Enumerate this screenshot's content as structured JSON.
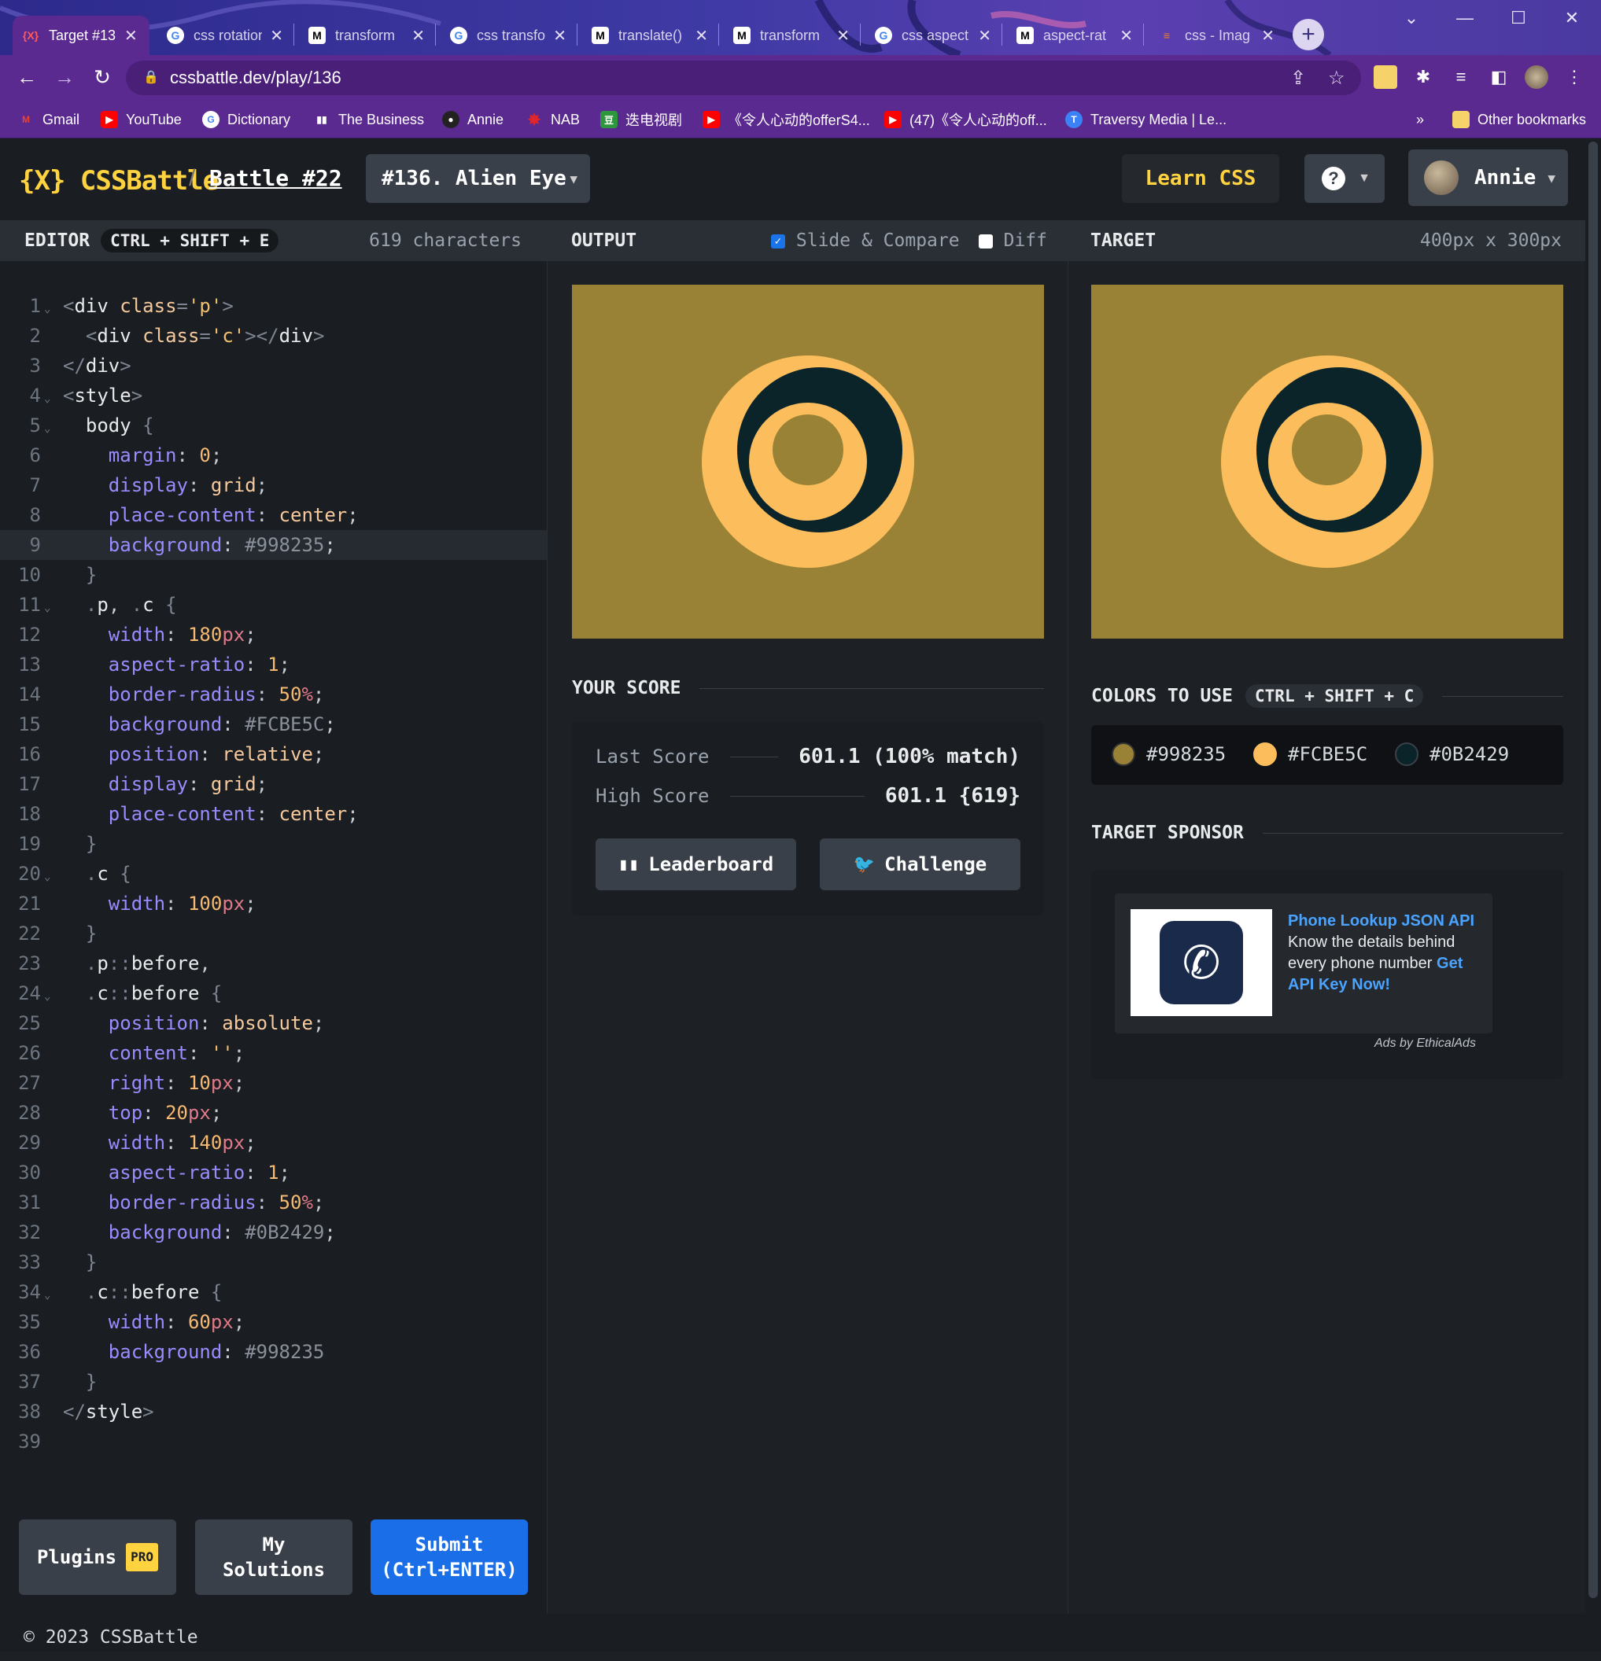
{
  "browser": {
    "tabs": [
      {
        "label": "Target #13",
        "icon": "cssbattle-icon",
        "active": true
      },
      {
        "label": "css rotation",
        "icon": "google-icon"
      },
      {
        "label": "transform",
        "icon": "mdn-icon"
      },
      {
        "label": "css transfo",
        "icon": "google-icon"
      },
      {
        "label": "translate()",
        "icon": "mdn-icon"
      },
      {
        "label": "transform",
        "icon": "mdn-icon"
      },
      {
        "label": "css aspect",
        "icon": "google-icon"
      },
      {
        "label": "aspect-rat",
        "icon": "mdn-icon"
      },
      {
        "label": "css - Imag",
        "icon": "stackoverflow-icon"
      }
    ],
    "url": "cssbattle.dev/play/136",
    "bookmarks": [
      {
        "label": "Gmail",
        "icon": "gmail-icon"
      },
      {
        "label": "YouTube",
        "icon": "youtube-icon"
      },
      {
        "label": "Dictionary",
        "icon": "google-icon"
      },
      {
        "label": "The Business",
        "icon": "business-icon"
      },
      {
        "label": "Annie",
        "icon": "github-icon"
      },
      {
        "label": "NAB",
        "icon": "nab-icon"
      },
      {
        "label": "迭电视剧",
        "icon": "douban-icon"
      },
      {
        "label": "《令人心动的offerS4...",
        "icon": "youtube-icon"
      },
      {
        "label": "(47)《令人心动的off...",
        "icon": "youtube-icon"
      },
      {
        "label": "Traversy Media | Le...",
        "icon": "traversy-icon"
      }
    ],
    "bookmarks_overflow": "»",
    "other_bookmarks": "Other bookmarks"
  },
  "header": {
    "logo": "{X} CSSBattle",
    "crumb_sep": "/",
    "battle": "Battle #22",
    "target": "#136. Alien Eye",
    "learn": "Learn CSS",
    "help": "?",
    "user": "Annie"
  },
  "editor": {
    "title": "EDITOR",
    "shortcut": "CTRL + SHIFT + E",
    "chars": "619 characters",
    "plugins": "Plugins",
    "pro": "PRO",
    "my_solutions_1": "My",
    "my_solutions_2": "Solutions",
    "submit_1": "Submit",
    "submit_2": "(Ctrl+ENTER)"
  },
  "output": {
    "title": "OUTPUT",
    "slide_compare": "Slide & Compare",
    "slide_compare_checked": true,
    "diff": "Diff",
    "diff_checked": false,
    "your_score": "YOUR SCORE",
    "last_score_label": "Last Score",
    "last_score": "601.1 (100% match)",
    "high_score_label": "High Score",
    "high_score": "601.1 {619}",
    "leaderboard": "Leaderboard",
    "challenge": "Challenge"
  },
  "target": {
    "title": "TARGET",
    "size": "400px x 300px",
    "colors_title": "COLORS TO USE",
    "colors_shortcut": "CTRL + SHIFT + C",
    "colors": [
      "#998235",
      "#FCBE5C",
      "#0B2429"
    ],
    "sponsor_title": "TARGET SPONSOR",
    "ad_title": "Phone Lookup JSON API",
    "ad_body": " Know the details behind every phone number ",
    "ad_cta": "Get API Key Now!",
    "ad_by": "Ads by EthicalAds"
  },
  "footer": "© 2023 CSSBattle"
}
